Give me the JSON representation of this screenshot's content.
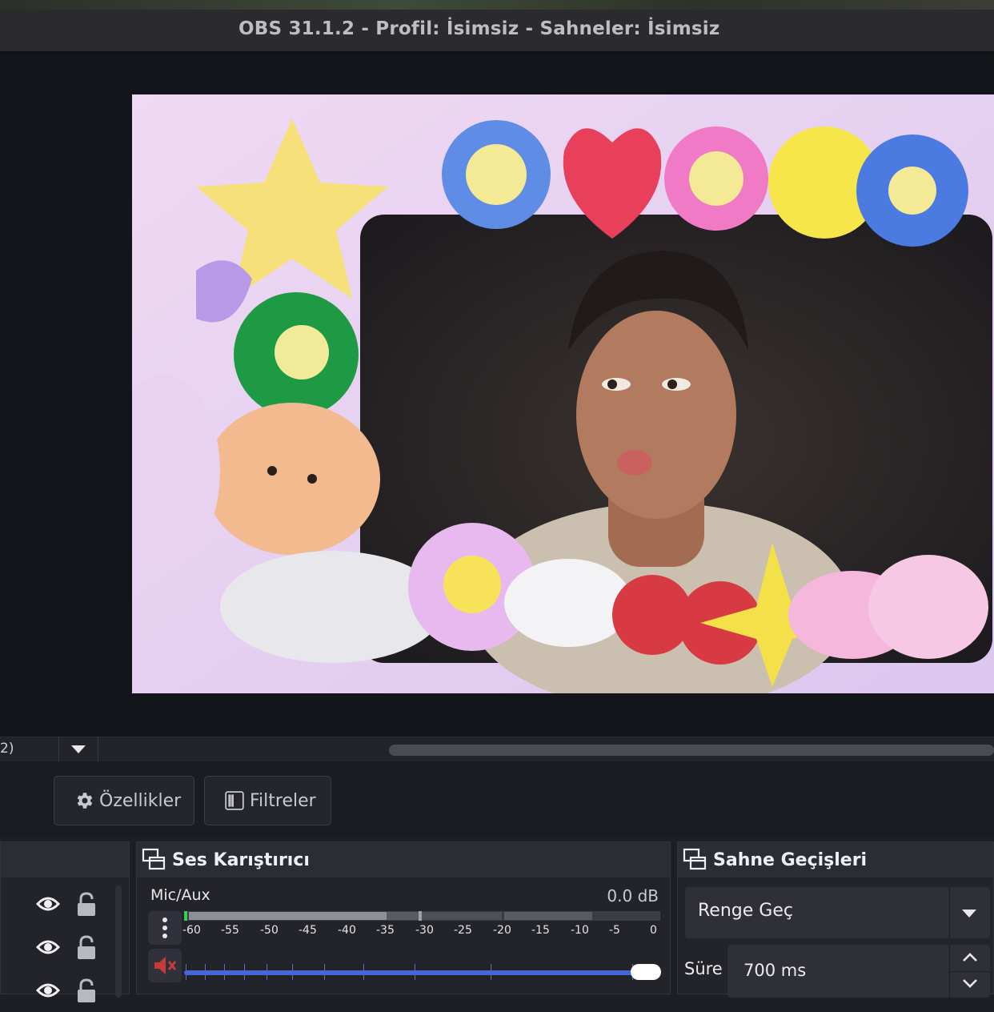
{
  "window": {
    "title": "OBS 31.1.2 - Profil: İsimsiz - Sahneler: İsimsiz"
  },
  "scene_bar": {
    "selected_label": "2)"
  },
  "toolbar": {
    "properties_label": "Özellikler",
    "filters_label": "Filtreler"
  },
  "audio_mixer": {
    "title": "Ses Karıştırıcı",
    "channel": {
      "name": "Mic/Aux",
      "level": "0.0 dB",
      "volume_fraction": 1.0
    },
    "scale": [
      "-60",
      "-55",
      "-50",
      "-45",
      "-40",
      "-35",
      "-30",
      "-25",
      "-20",
      "-15",
      "-10",
      "-5",
      "0"
    ]
  },
  "transitions": {
    "title": "Sahne Geçişleri",
    "selected": "Renge Geç",
    "duration_label": "Süre",
    "duration_value": "700 ms"
  },
  "colors": {
    "accent_blue": "#4466d6",
    "mute_red": "#c83a3a",
    "meter_green": "#2fd24a"
  }
}
